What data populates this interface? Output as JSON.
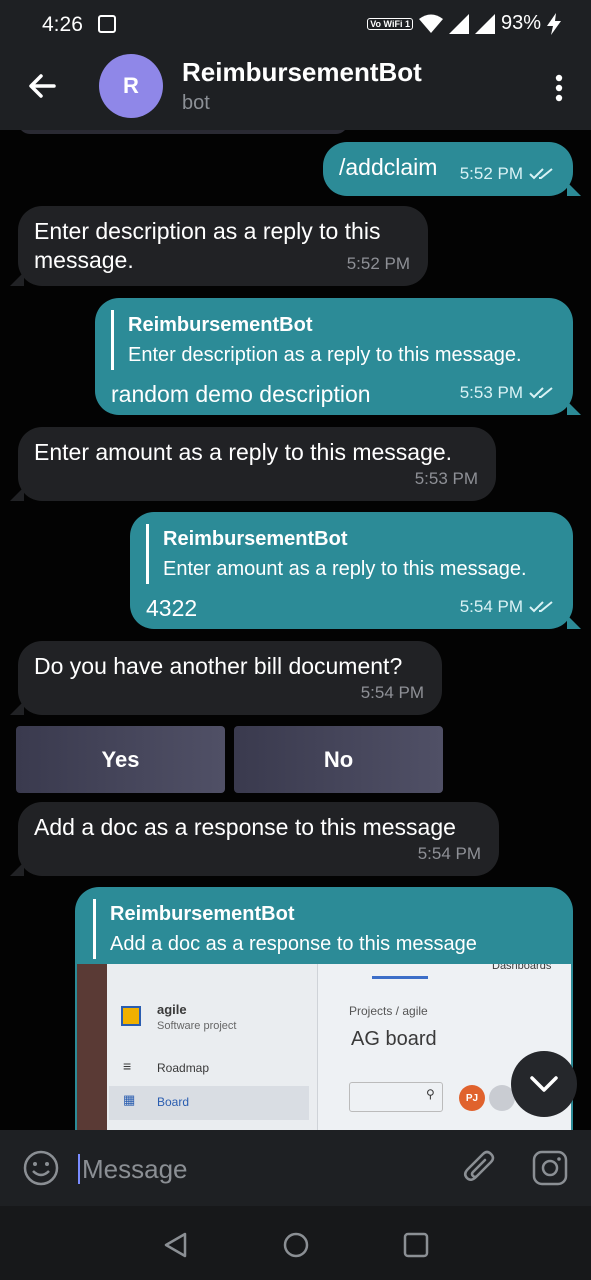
{
  "status": {
    "time": "4:26",
    "volte": "Vo WiFi 1",
    "battery": "93%"
  },
  "header": {
    "avatar_letter": "R",
    "title": "ReimbursementBot",
    "subtitle": "bot"
  },
  "messages": {
    "m1": {
      "text": "/addclaim",
      "time": "5:52 PM"
    },
    "m2": {
      "text": "Enter description as a reply to this message.",
      "time": "5:52 PM"
    },
    "m3": {
      "reply_author": "ReimbursementBot",
      "reply_text": "Enter description as a reply to this message.",
      "text": "random demo description",
      "time": "5:53 PM"
    },
    "m4": {
      "text": "Enter amount as a reply to this message.",
      "time": "5:53 PM"
    },
    "m5": {
      "reply_author": "ReimbursementBot",
      "reply_text": "Enter amount as a reply to this message.",
      "text": "4322",
      "time": "5:54 PM"
    },
    "m6": {
      "text": "Do you have another bill document?",
      "time": "5:54 PM"
    },
    "m7": {
      "text": "Add a doc as a response to this message",
      "time": "5:54 PM"
    },
    "m8": {
      "reply_author": "ReimbursementBot",
      "reply_text": "Add a doc as a response to this message"
    }
  },
  "keyboard": {
    "yes": "Yes",
    "no": "No"
  },
  "photo": {
    "tab_label": "Dashboards",
    "project_name": "agile",
    "project_type": "Software project",
    "roadmap": "Roadmap",
    "board": "Board",
    "breadcrumb": "Projects  /  agile",
    "board_title": "AG board",
    "avatar": "PJ"
  },
  "input": {
    "placeholder": "Message"
  },
  "colors": {
    "outgoing": "#2c8b97",
    "incoming": "#212225",
    "avatar": "#8f87e8"
  }
}
